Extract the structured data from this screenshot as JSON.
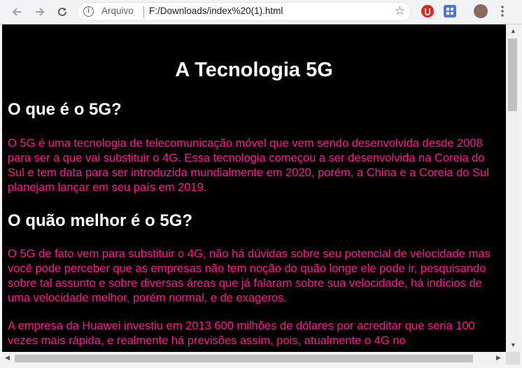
{
  "browser": {
    "origin_label": "Arquivo",
    "url": "F:/Downloads/index%20(1).html",
    "icons": {
      "back": "back-arrow-icon",
      "forward": "forward-arrow-icon",
      "reload": "reload-icon",
      "info": "info-icon",
      "bookmark": "star-icon",
      "menu": "kebab-menu-icon"
    }
  },
  "page": {
    "background": "#000000",
    "heading_color": "#ffffff",
    "text_color": "#ff1493",
    "title": "A Tecnologia 5G",
    "sections": [
      {
        "heading": "O que é o 5G?",
        "paragraphs": [
          "O 5G é uma tecnologia de telecomunicação móvel que vem sendo desenvolvida desde 2008 para ser a que vai substituir o 4G. Essa tecnologia começou a ser desenvolvida na Coreia do Sul e tem data para ser introduzida mundialmente em 2020, porém, a China e a Coreia do Sul planejam lançar em seu país em 2019."
        ]
      },
      {
        "heading": "O quão melhor é o 5G?",
        "paragraphs": [
          "O 5G de fato vem para substituir o 4G, não há dúvidas sobre seu potencial de velocidade mas você pode perceber que as empresas não tem noção do quão longe ele pode ir, pesquisando sobre tal assunto e sobre diversas áreas que já falaram sobre sua velocidade, há indícios de uma velocidade melhor, porém normal, e de exageros.",
          "A empresa da Huawei investiu em 2013 600 milhões de dólares por acreditar que seria 100 vezes mais rápida, e realmente há previsões assim, pois, atualmente o 4G no"
        ]
      }
    ]
  }
}
